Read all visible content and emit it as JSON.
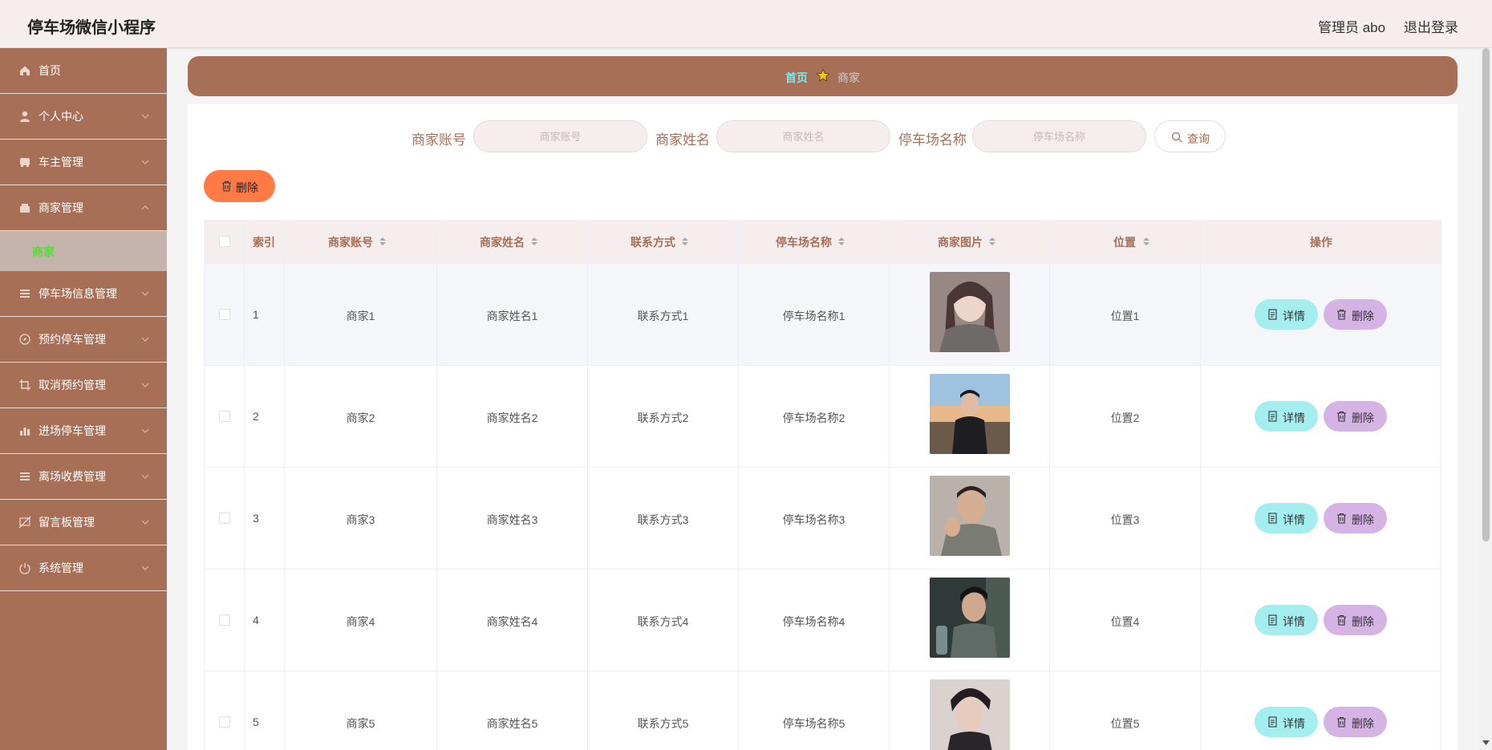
{
  "app": {
    "title": "停车场微信小程序",
    "admin": "管理员 abo",
    "logout": "退出登录"
  },
  "sidebar": {
    "items": [
      {
        "label": "首页",
        "icon": "home-icon"
      },
      {
        "label": "个人中心",
        "icon": "user-icon"
      },
      {
        "label": "车主管理",
        "icon": "car-icon"
      },
      {
        "label": "商家管理",
        "icon": "shop-icon",
        "expanded": true
      },
      {
        "label": "停车场信息管理",
        "icon": "list-icon"
      },
      {
        "label": "预约停车管理",
        "icon": "compass-icon"
      },
      {
        "label": "取消预约管理",
        "icon": "crop-icon"
      },
      {
        "label": "进场停车管理",
        "icon": "bar-chart-icon"
      },
      {
        "label": "离场收费管理",
        "icon": "list-icon"
      },
      {
        "label": "留言板管理",
        "icon": "message-off-icon"
      },
      {
        "label": "系统管理",
        "icon": "power-icon"
      }
    ],
    "submenu": {
      "label": "商家"
    }
  },
  "breadcrumb": {
    "home": "首页",
    "current": "商家"
  },
  "search": {
    "fields": [
      {
        "label": "商家账号",
        "placeholder": "商家账号"
      },
      {
        "label": "商家姓名",
        "placeholder": "商家姓名"
      },
      {
        "label": "停车场名称",
        "placeholder": "停车场名称"
      }
    ],
    "query_label": "查询"
  },
  "toolbar": {
    "delete_label": "删除"
  },
  "table": {
    "headers": [
      "索引",
      "商家账号",
      "商家姓名",
      "联系方式",
      "停车场名称",
      "商家图片",
      "位置",
      "操作"
    ],
    "rows": [
      {
        "index": "1",
        "account": "商家1",
        "name": "商家姓名1",
        "contact": "联系方式1",
        "lot": "停车场名称1",
        "location": "位置1"
      },
      {
        "index": "2",
        "account": "商家2",
        "name": "商家姓名2",
        "contact": "联系方式2",
        "lot": "停车场名称2",
        "location": "位置2"
      },
      {
        "index": "3",
        "account": "商家3",
        "name": "商家姓名3",
        "contact": "联系方式3",
        "lot": "停车场名称3",
        "location": "位置3"
      },
      {
        "index": "4",
        "account": "商家4",
        "name": "商家姓名4",
        "contact": "联系方式4",
        "lot": "停车场名称4",
        "location": "位置4"
      },
      {
        "index": "5",
        "account": "商家5",
        "name": "商家姓名5",
        "contact": "联系方式5",
        "lot": "停车场名称5",
        "location": "位置5"
      }
    ],
    "detail_label": "详情",
    "delete_label": "删除"
  },
  "colors": {
    "primary": "#a66f56",
    "header_bg": "#f6eeee",
    "accent": "#7fe7ea",
    "danger": "#ff7a45",
    "detail_btn": "#a5eef0",
    "delete_btn": "#d6b3e5",
    "submenu_text": "#52e032"
  }
}
